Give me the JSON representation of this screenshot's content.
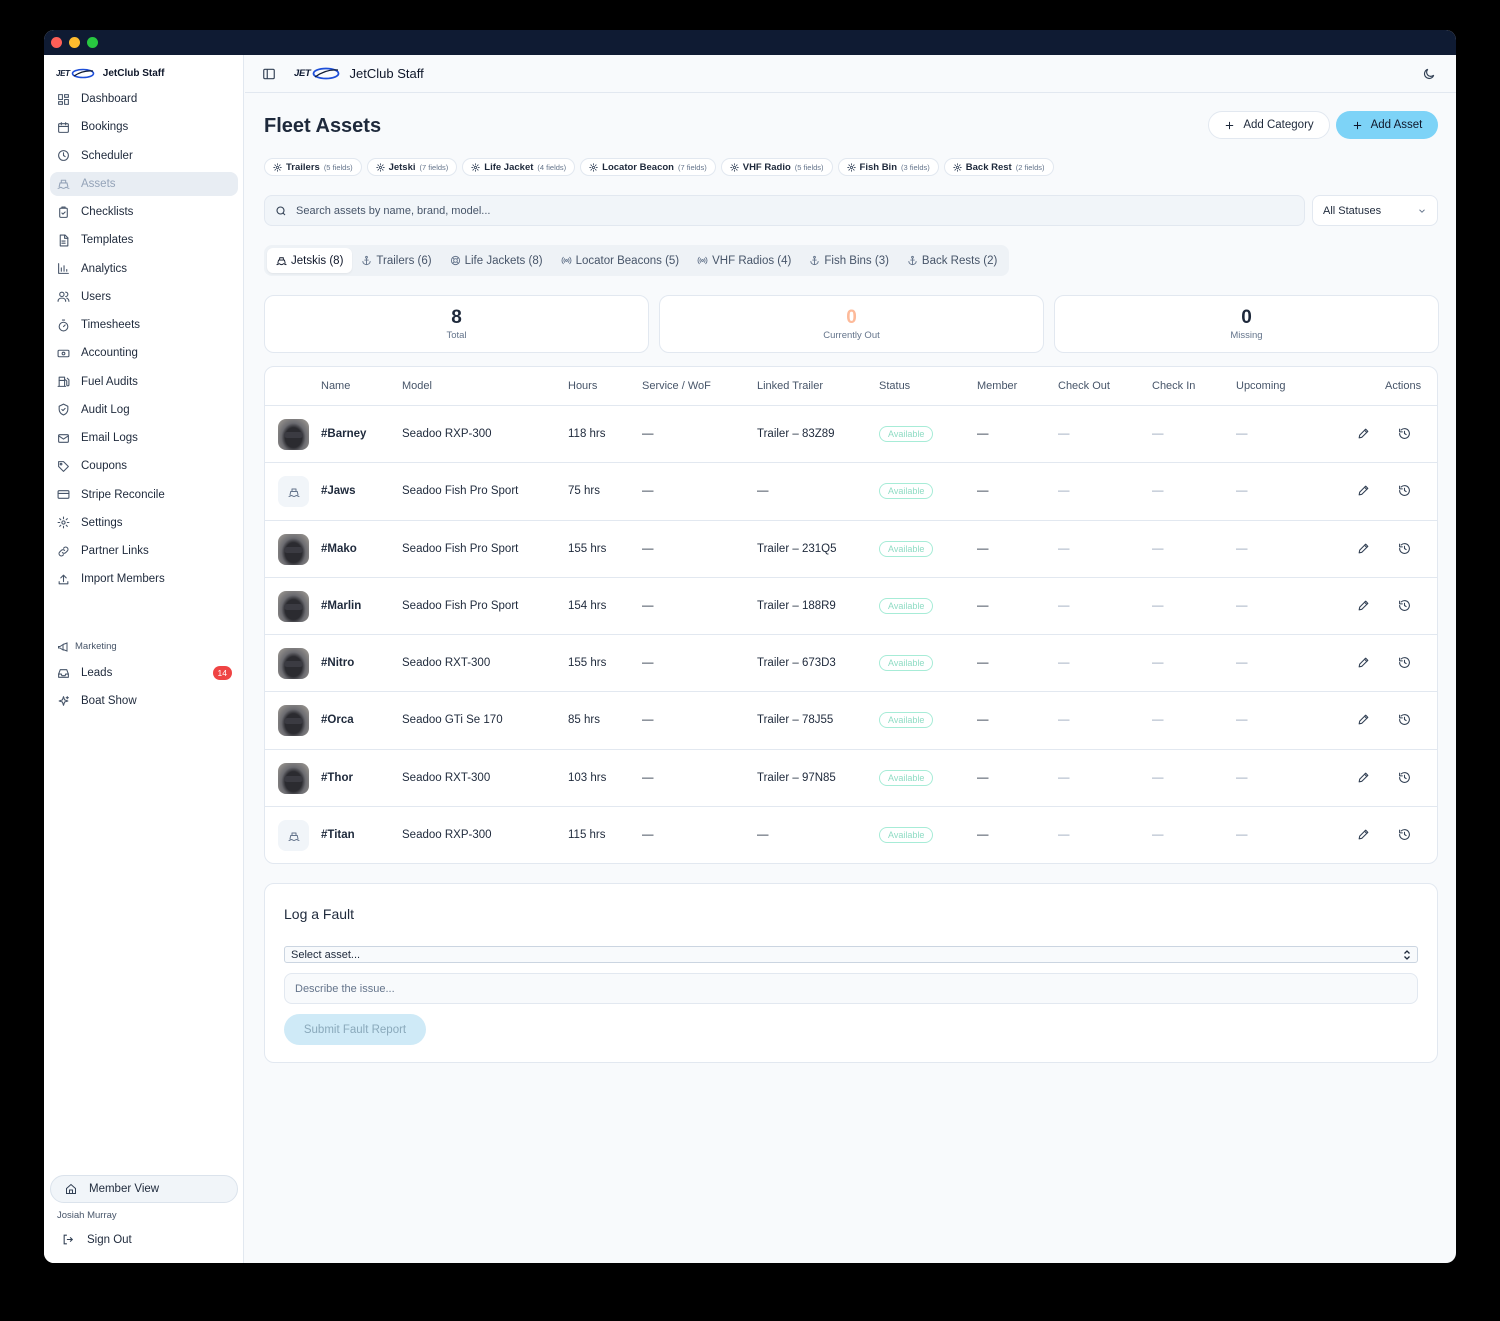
{
  "sidebar": {
    "brand_logo_text": "JET",
    "brand_name": "JetClub Staff",
    "items": [
      {
        "label": "Dashboard",
        "icon": "dashboard-icon"
      },
      {
        "label": "Bookings",
        "icon": "calendar-icon"
      },
      {
        "label": "Scheduler",
        "icon": "clock-icon"
      },
      {
        "label": "Assets",
        "icon": "ship-icon",
        "active": true
      },
      {
        "label": "Checklists",
        "icon": "clipboard-check-icon"
      },
      {
        "label": "Templates",
        "icon": "file-text-icon"
      },
      {
        "label": "Analytics",
        "icon": "bar-chart-icon"
      },
      {
        "label": "Users",
        "icon": "users-icon"
      },
      {
        "label": "Timesheets",
        "icon": "timer-icon"
      },
      {
        "label": "Accounting",
        "icon": "banknote-icon"
      },
      {
        "label": "Fuel Audits",
        "icon": "fuel-icon"
      },
      {
        "label": "Audit Log",
        "icon": "shield-icon"
      },
      {
        "label": "Email Logs",
        "icon": "mail-icon"
      },
      {
        "label": "Coupons",
        "icon": "tag-icon"
      },
      {
        "label": "Stripe Reconcile",
        "icon": "credit-card-icon"
      },
      {
        "label": "Settings",
        "icon": "gear-icon"
      },
      {
        "label": "Partner Links",
        "icon": "link-icon"
      },
      {
        "label": "Import Members",
        "icon": "upload-icon"
      }
    ],
    "section_label": "Marketing",
    "marketing_items": [
      {
        "label": "Leads",
        "icon": "inbox-icon",
        "badge": "14"
      },
      {
        "label": "Boat Show",
        "icon": "sparkles-icon"
      }
    ],
    "member_view_label": "Member View",
    "user_name": "Josiah Murray",
    "sign_out_label": "Sign Out"
  },
  "header": {
    "logo_text": "JET",
    "title": "JetClub Staff"
  },
  "main": {
    "page_title": "Fleet Assets",
    "add_category_label": "Add Category",
    "add_asset_label": "Add Asset",
    "categories": [
      {
        "name": "Trailers",
        "fields": "(5 fields)"
      },
      {
        "name": "Jetski",
        "fields": "(7 fields)"
      },
      {
        "name": "Life Jacket",
        "fields": "(4 fields)"
      },
      {
        "name": "Locator Beacon",
        "fields": "(7 fields)"
      },
      {
        "name": "VHF Radio",
        "fields": "(5 fields)"
      },
      {
        "name": "Fish Bin",
        "fields": "(3 fields)"
      },
      {
        "name": "Back Rest",
        "fields": "(2 fields)"
      }
    ],
    "search_placeholder": "Search assets by name, brand, model...",
    "status_filter": "All Statuses",
    "tabs": [
      {
        "label": "Jetskis (8)",
        "icon": "ship-icon",
        "active": true
      },
      {
        "label": "Trailers (6)",
        "icon": "anchor-icon"
      },
      {
        "label": "Life Jackets (8)",
        "icon": "life-buoy-icon"
      },
      {
        "label": "Locator Beacons (5)",
        "icon": "radio-icon"
      },
      {
        "label": "VHF Radios (4)",
        "icon": "radio-icon"
      },
      {
        "label": "Fish Bins (3)",
        "icon": "anchor-icon"
      },
      {
        "label": "Back Rests (2)",
        "icon": "anchor-icon"
      }
    ],
    "stats": [
      {
        "value": "8",
        "label": "Total"
      },
      {
        "value": "0",
        "label": "Currently Out"
      },
      {
        "value": "0",
        "label": "Missing"
      }
    ],
    "columns": [
      "Name",
      "Model",
      "Hours",
      "Service / WoF",
      "Linked Trailer",
      "Status",
      "Member",
      "Check Out",
      "Check In",
      "Upcoming",
      "Actions"
    ],
    "rows": [
      {
        "photo": true,
        "name": "#Barney",
        "model": "Seadoo RXP-300",
        "hours": "118 hrs",
        "service": "—",
        "trailer": "Trailer – 83Z89",
        "status": "Available",
        "member": "—",
        "check_out": "—",
        "check_in": "—",
        "upcoming": "—"
      },
      {
        "photo": false,
        "name": "#Jaws",
        "model": "Seadoo Fish Pro Sport",
        "hours": "75 hrs",
        "service": "—",
        "trailer": "—",
        "status": "Available",
        "member": "—",
        "check_out": "—",
        "check_in": "—",
        "upcoming": "—"
      },
      {
        "photo": true,
        "name": "#Mako",
        "model": "Seadoo Fish Pro Sport",
        "hours": "155 hrs",
        "service": "—",
        "trailer": "Trailer – 231Q5",
        "status": "Available",
        "member": "—",
        "check_out": "—",
        "check_in": "—",
        "upcoming": "—"
      },
      {
        "photo": true,
        "name": "#Marlin",
        "model": "Seadoo Fish Pro Sport",
        "hours": "154 hrs",
        "service": "—",
        "trailer": "Trailer – 188R9",
        "status": "Available",
        "member": "—",
        "check_out": "—",
        "check_in": "—",
        "upcoming": "—"
      },
      {
        "photo": true,
        "name": "#Nitro",
        "model": "Seadoo RXT-300",
        "hours": "155 hrs",
        "service": "—",
        "trailer": "Trailer – 673D3",
        "status": "Available",
        "member": "—",
        "check_out": "—",
        "check_in": "—",
        "upcoming": "—"
      },
      {
        "photo": true,
        "name": "#Orca",
        "model": "Seadoo GTi Se 170",
        "hours": "85 hrs",
        "service": "—",
        "trailer": "Trailer – 78J55",
        "status": "Available",
        "member": "—",
        "check_out": "—",
        "check_in": "—",
        "upcoming": "—"
      },
      {
        "photo": true,
        "name": "#Thor",
        "model": "Seadoo RXT-300",
        "hours": "103 hrs",
        "service": "—",
        "trailer": "Trailer – 97N85",
        "status": "Available",
        "member": "—",
        "check_out": "—",
        "check_in": "—",
        "upcoming": "—"
      },
      {
        "photo": false,
        "name": "#Titan",
        "model": "Seadoo RXP-300",
        "hours": "115 hrs",
        "service": "—",
        "trailer": "—",
        "status": "Available",
        "member": "—",
        "check_out": "—",
        "check_in": "—",
        "upcoming": "—"
      }
    ]
  },
  "fault": {
    "title": "Log a Fault",
    "select_value": "Select asset...",
    "issue_placeholder": "Describe the issue...",
    "submit_label": "Submit Fault Report"
  },
  "colors": {
    "accent": "#7dd3f7",
    "titlebar": "#0f1b33",
    "badge": "#ef4444",
    "available": "#8fdcc4",
    "currently_out": "#fdba9a"
  }
}
